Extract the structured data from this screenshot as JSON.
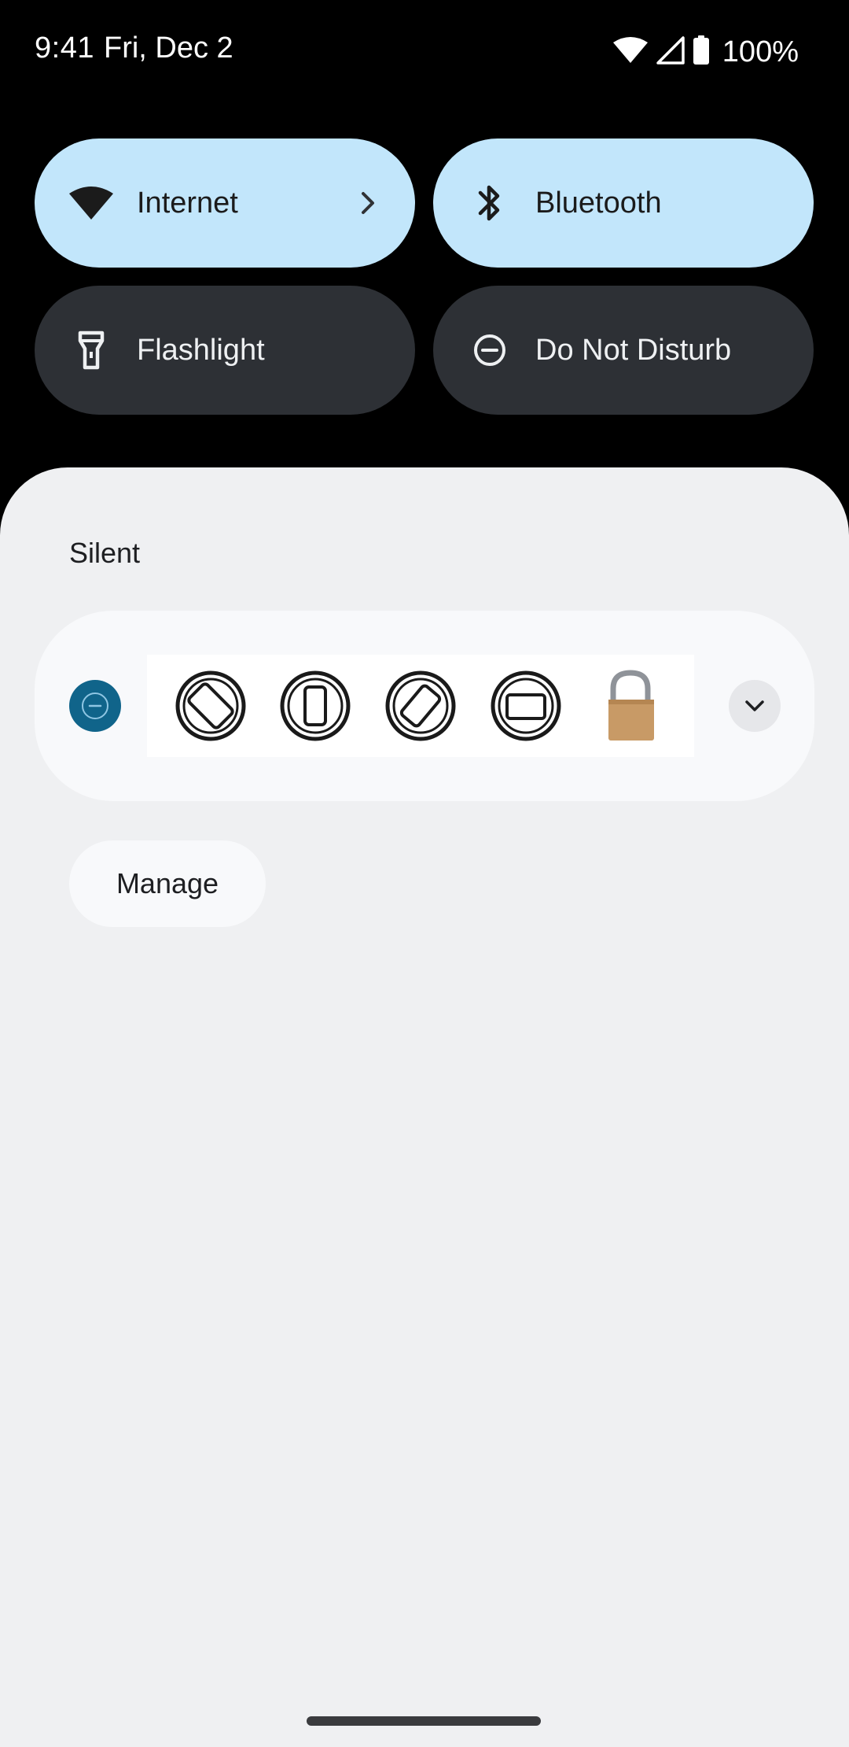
{
  "status_bar": {
    "time": "9:41",
    "date": "Fri, Dec 2",
    "battery_percent": "100%",
    "icons": [
      "wifi-icon",
      "cell-signal-icon",
      "battery-icon"
    ]
  },
  "quick_settings": {
    "tiles": [
      {
        "label": "Internet",
        "icon": "wifi-icon",
        "active": true,
        "has_chevron": true
      },
      {
        "label": "Bluetooth",
        "icon": "bluetooth-icon",
        "active": true
      },
      {
        "label": "Flashlight",
        "icon": "flashlight-icon",
        "active": false
      },
      {
        "label": "Do Not Disturb",
        "icon": "do-not-disturb-icon",
        "active": false
      }
    ],
    "colors": {
      "active": "#c2e6fb",
      "inactive": "#2d3035"
    }
  },
  "notifications": {
    "section_header": "Silent",
    "card": {
      "app_icon": "do-not-disturb-icon",
      "app_icon_color": "#10648a",
      "content_icons": [
        "rotate-screen-icon",
        "portrait-phone-icon",
        "rotate-landscape-icon",
        "tablet-landscape-icon",
        "unlocked-padlock-icon"
      ],
      "expand_icon": "chevron-down-icon"
    },
    "manage_label": "Manage"
  }
}
